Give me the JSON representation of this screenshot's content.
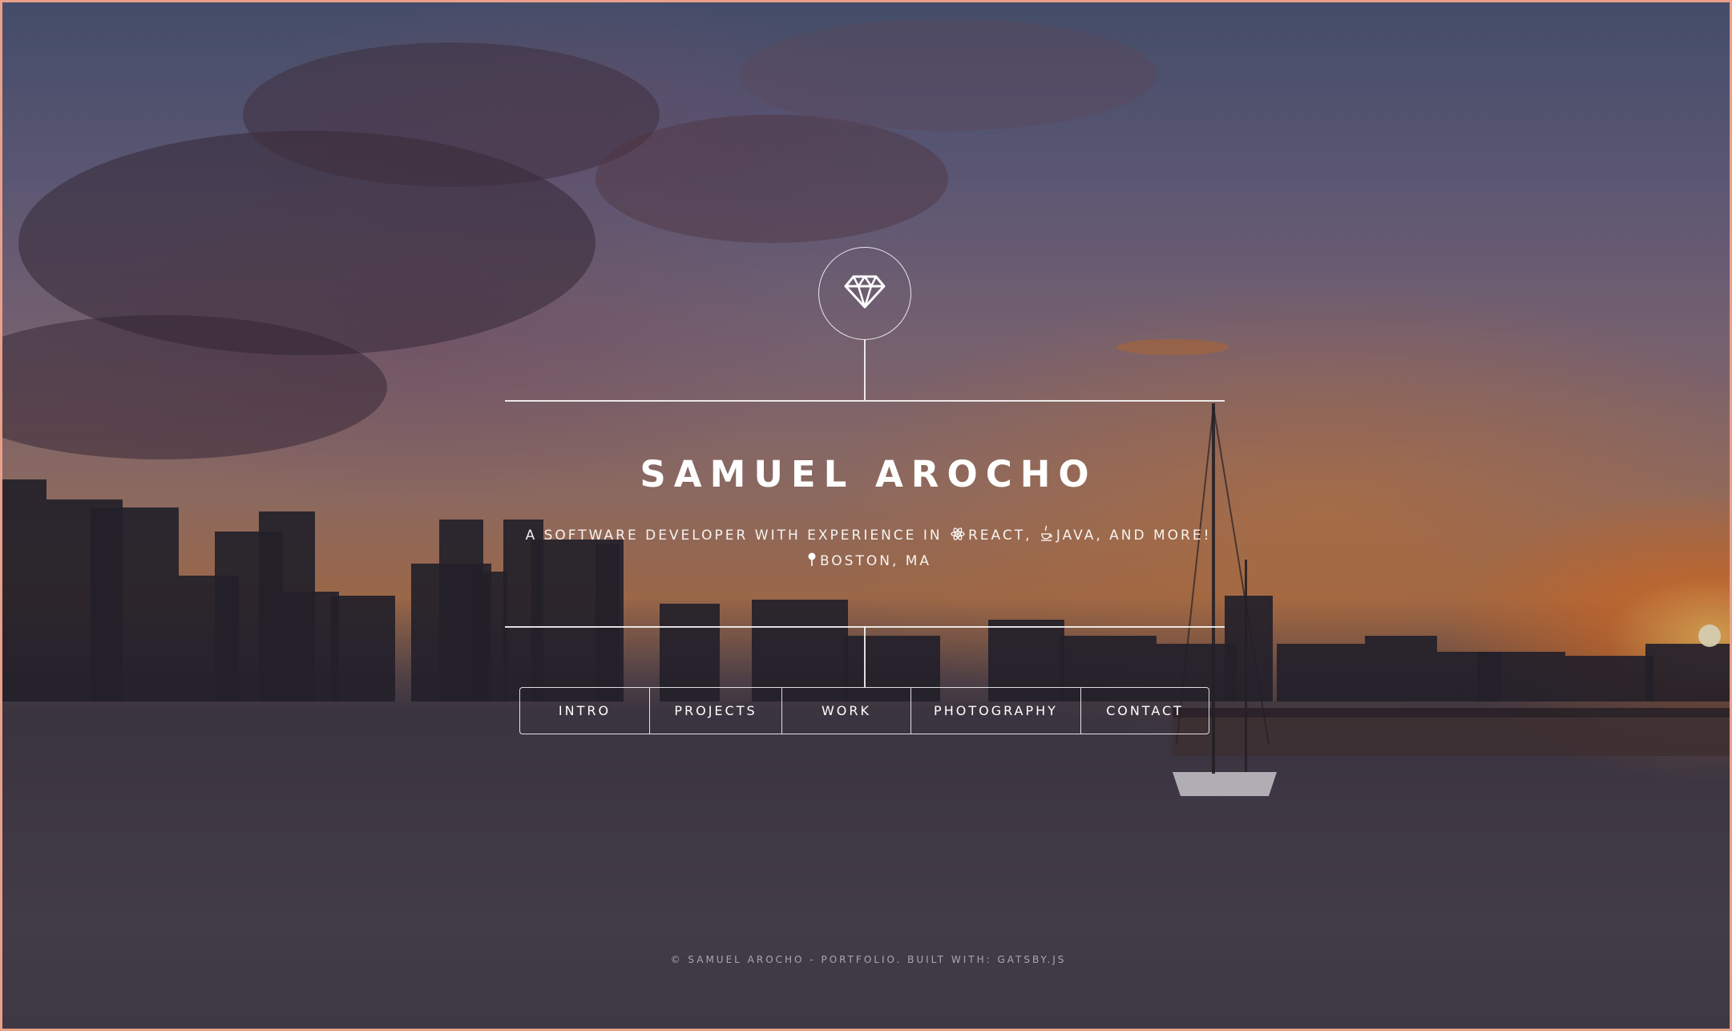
{
  "header": {
    "logo_icon": "diamond-icon",
    "name": "SAMUEL AROCHO",
    "tagline_part1": "A SOFTWARE DEVELOPER WITH EXPERIENCE IN",
    "tagline_react": "REACT,",
    "tagline_react_icon": "react-atom-icon",
    "tagline_java": "JAVA, AND MORE!",
    "tagline_java_icon": "java-coffee-icon",
    "location_icon": "map-pin-icon",
    "location": "BOSTON, MA"
  },
  "nav": {
    "items": [
      {
        "label": "INTRO"
      },
      {
        "label": "PROJECTS"
      },
      {
        "label": "WORK"
      },
      {
        "label": "PHOTOGRAPHY"
      },
      {
        "label": "CONTACT"
      }
    ]
  },
  "footer": {
    "text": "© SAMUEL AROCHO - PORTFOLIO. BUILT WITH: GATSBY.JS"
  },
  "theme": {
    "line_color": "#ffffff",
    "frame_color": "#e9a08a"
  }
}
